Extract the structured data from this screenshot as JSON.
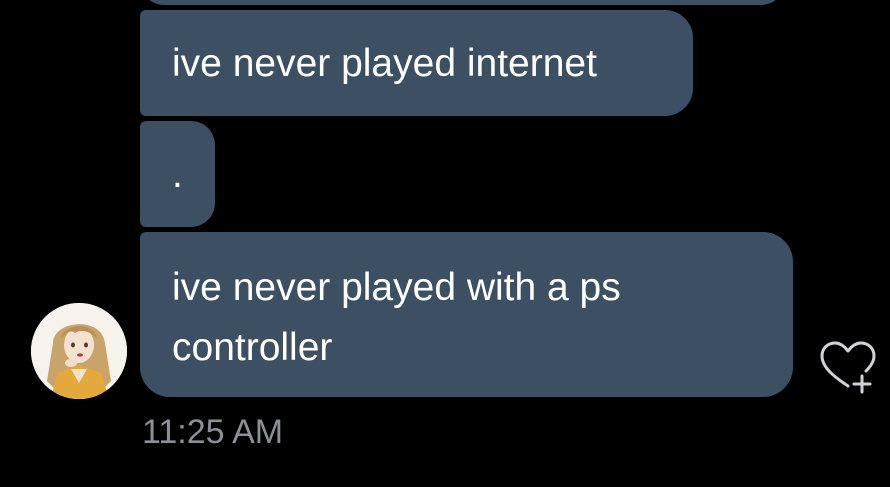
{
  "messages": [
    {
      "text": ""
    },
    {
      "text": "ive never played internet"
    },
    {
      "text": "."
    },
    {
      "text": "ive never played with a ps controller"
    }
  ],
  "timestamp": "11:25 AM",
  "colors": {
    "background": "#000000",
    "bubble": "#3d5063",
    "text": "#ffffff",
    "timestamp": "#8a9096",
    "icon": "#cfd3d7"
  },
  "icons": {
    "reaction": "heart-plus-icon"
  }
}
